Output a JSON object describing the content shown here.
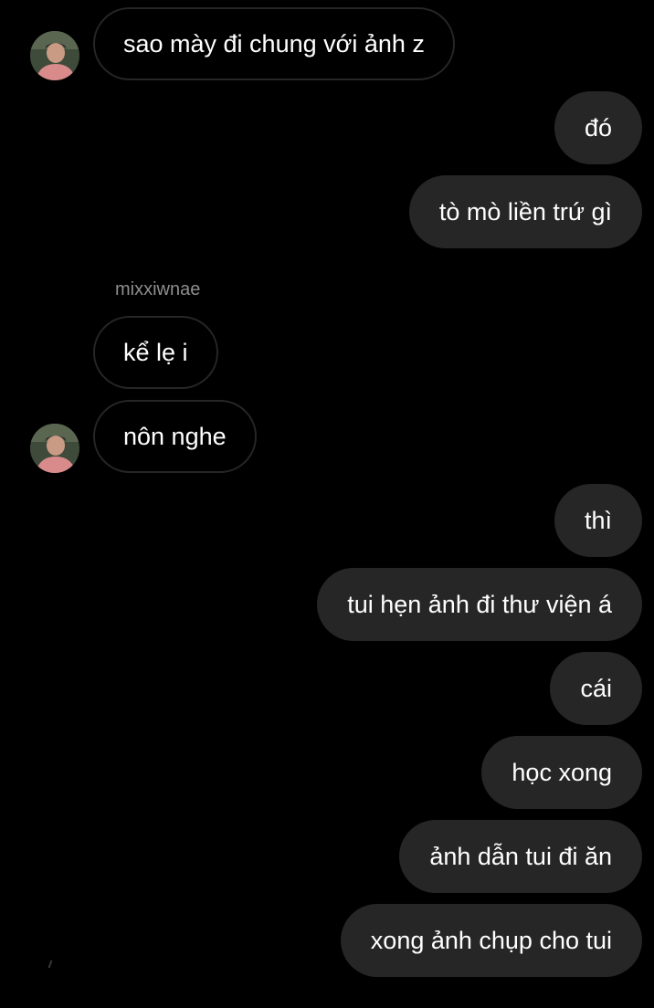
{
  "colors": {
    "background": "#000000",
    "incoming_border": "#262626",
    "outgoing_bubble": "#262626",
    "text": "#ffffff",
    "sender_name": "#8e8e8e"
  },
  "contact": {
    "name": "mixxiwnae",
    "avatar_icon": "profile-photo"
  },
  "messages": [
    {
      "direction": "incoming",
      "text": "sao mày đi chung với ảnh z",
      "avatar": true
    },
    {
      "direction": "outgoing",
      "text": "đó"
    },
    {
      "direction": "outgoing",
      "text": "tò mò liền trứ gì"
    },
    {
      "direction": "incoming",
      "text": "kể lẹ i",
      "sender_label": true
    },
    {
      "direction": "incoming",
      "text": "nôn nghe",
      "avatar": true
    },
    {
      "direction": "outgoing",
      "text": "thì"
    },
    {
      "direction": "outgoing",
      "text": "tui hẹn ảnh đi thư viện á"
    },
    {
      "direction": "outgoing",
      "text": "cái"
    },
    {
      "direction": "outgoing",
      "text": "học xong"
    },
    {
      "direction": "outgoing",
      "text": "ảnh dẫn tui đi ăn"
    },
    {
      "direction": "outgoing",
      "text": "xong ảnh chụp cho tui"
    }
  ]
}
